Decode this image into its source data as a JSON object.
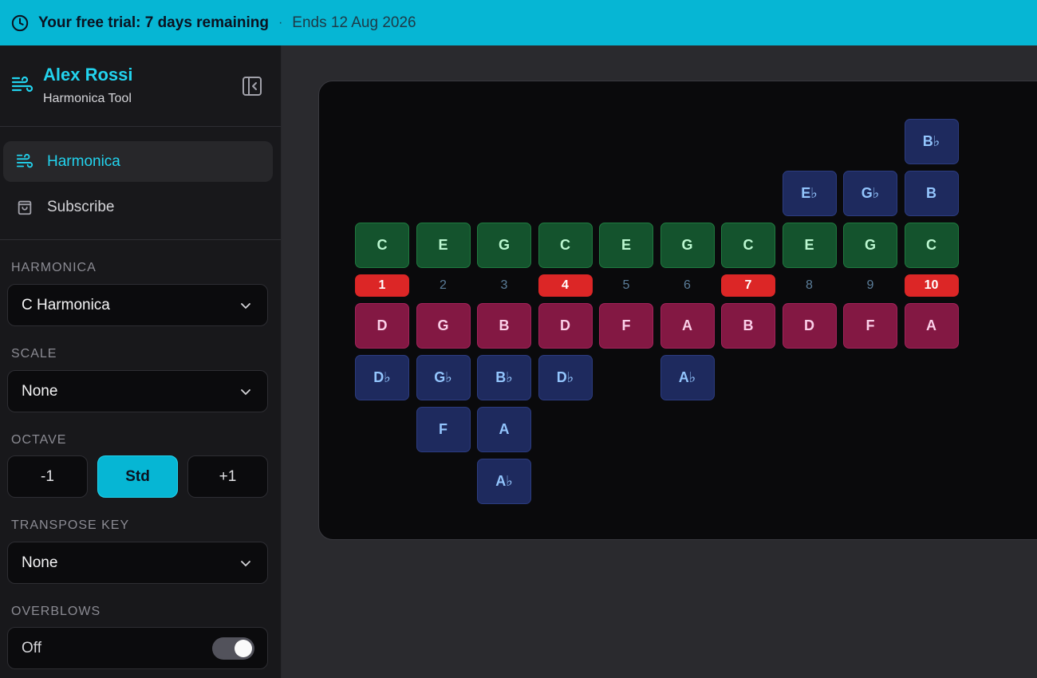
{
  "banner": {
    "title": "Your free trial: 7 days remaining",
    "separator": "·",
    "ends": "Ends 12 Aug 2026"
  },
  "brand": {
    "name": "Alex Rossi",
    "subtitle": "Harmonica Tool"
  },
  "nav": {
    "harmonica": "Harmonica",
    "subscribe": "Subscribe"
  },
  "controls": {
    "harmonica_label": "HARMONICA",
    "harmonica_value": "C Harmonica",
    "scale_label": "SCALE",
    "scale_value": "None",
    "octave_label": "OCTAVE",
    "octave_minus": "-1",
    "octave_std": "Std",
    "octave_plus": "+1",
    "transpose_label": "TRANSPOSE KEY",
    "transpose_value": "None",
    "overblows_label": "OVERBLOWS",
    "overblows_value": "Off",
    "overblows_on": false
  },
  "colors": {
    "accent": "#06b6d4",
    "blow": "#14532d",
    "draw": "#831843",
    "bend": "#1e2a5e",
    "marker": "#dc2626"
  },
  "harmonica": {
    "holes": [
      "1",
      "2",
      "3",
      "4",
      "5",
      "6",
      "7",
      "8",
      "9",
      "10"
    ],
    "marked_holes": [
      "1",
      "4",
      "7",
      "10"
    ],
    "blow": [
      "C",
      "E",
      "G",
      "C",
      "E",
      "G",
      "C",
      "E",
      "G",
      "C"
    ],
    "draw": [
      "D",
      "G",
      "B",
      "D",
      "F",
      "A",
      "B",
      "D",
      "F",
      "A"
    ],
    "blow_bends": [
      {
        "hole": "8",
        "level": 1,
        "note": "E♭"
      },
      {
        "hole": "9",
        "level": 1,
        "note": "G♭"
      },
      {
        "hole": "10",
        "level": 1,
        "note": "B"
      },
      {
        "hole": "10",
        "level": 2,
        "note": "B♭"
      }
    ],
    "draw_bends": [
      {
        "hole": "1",
        "level": 1,
        "note": "D♭"
      },
      {
        "hole": "2",
        "level": 1,
        "note": "G♭"
      },
      {
        "hole": "2",
        "level": 2,
        "note": "F"
      },
      {
        "hole": "3",
        "level": 1,
        "note": "B♭"
      },
      {
        "hole": "3",
        "level": 2,
        "note": "A"
      },
      {
        "hole": "3",
        "level": 3,
        "note": "A♭"
      },
      {
        "hole": "4",
        "level": 1,
        "note": "D♭"
      },
      {
        "hole": "6",
        "level": 1,
        "note": "A♭"
      }
    ]
  }
}
